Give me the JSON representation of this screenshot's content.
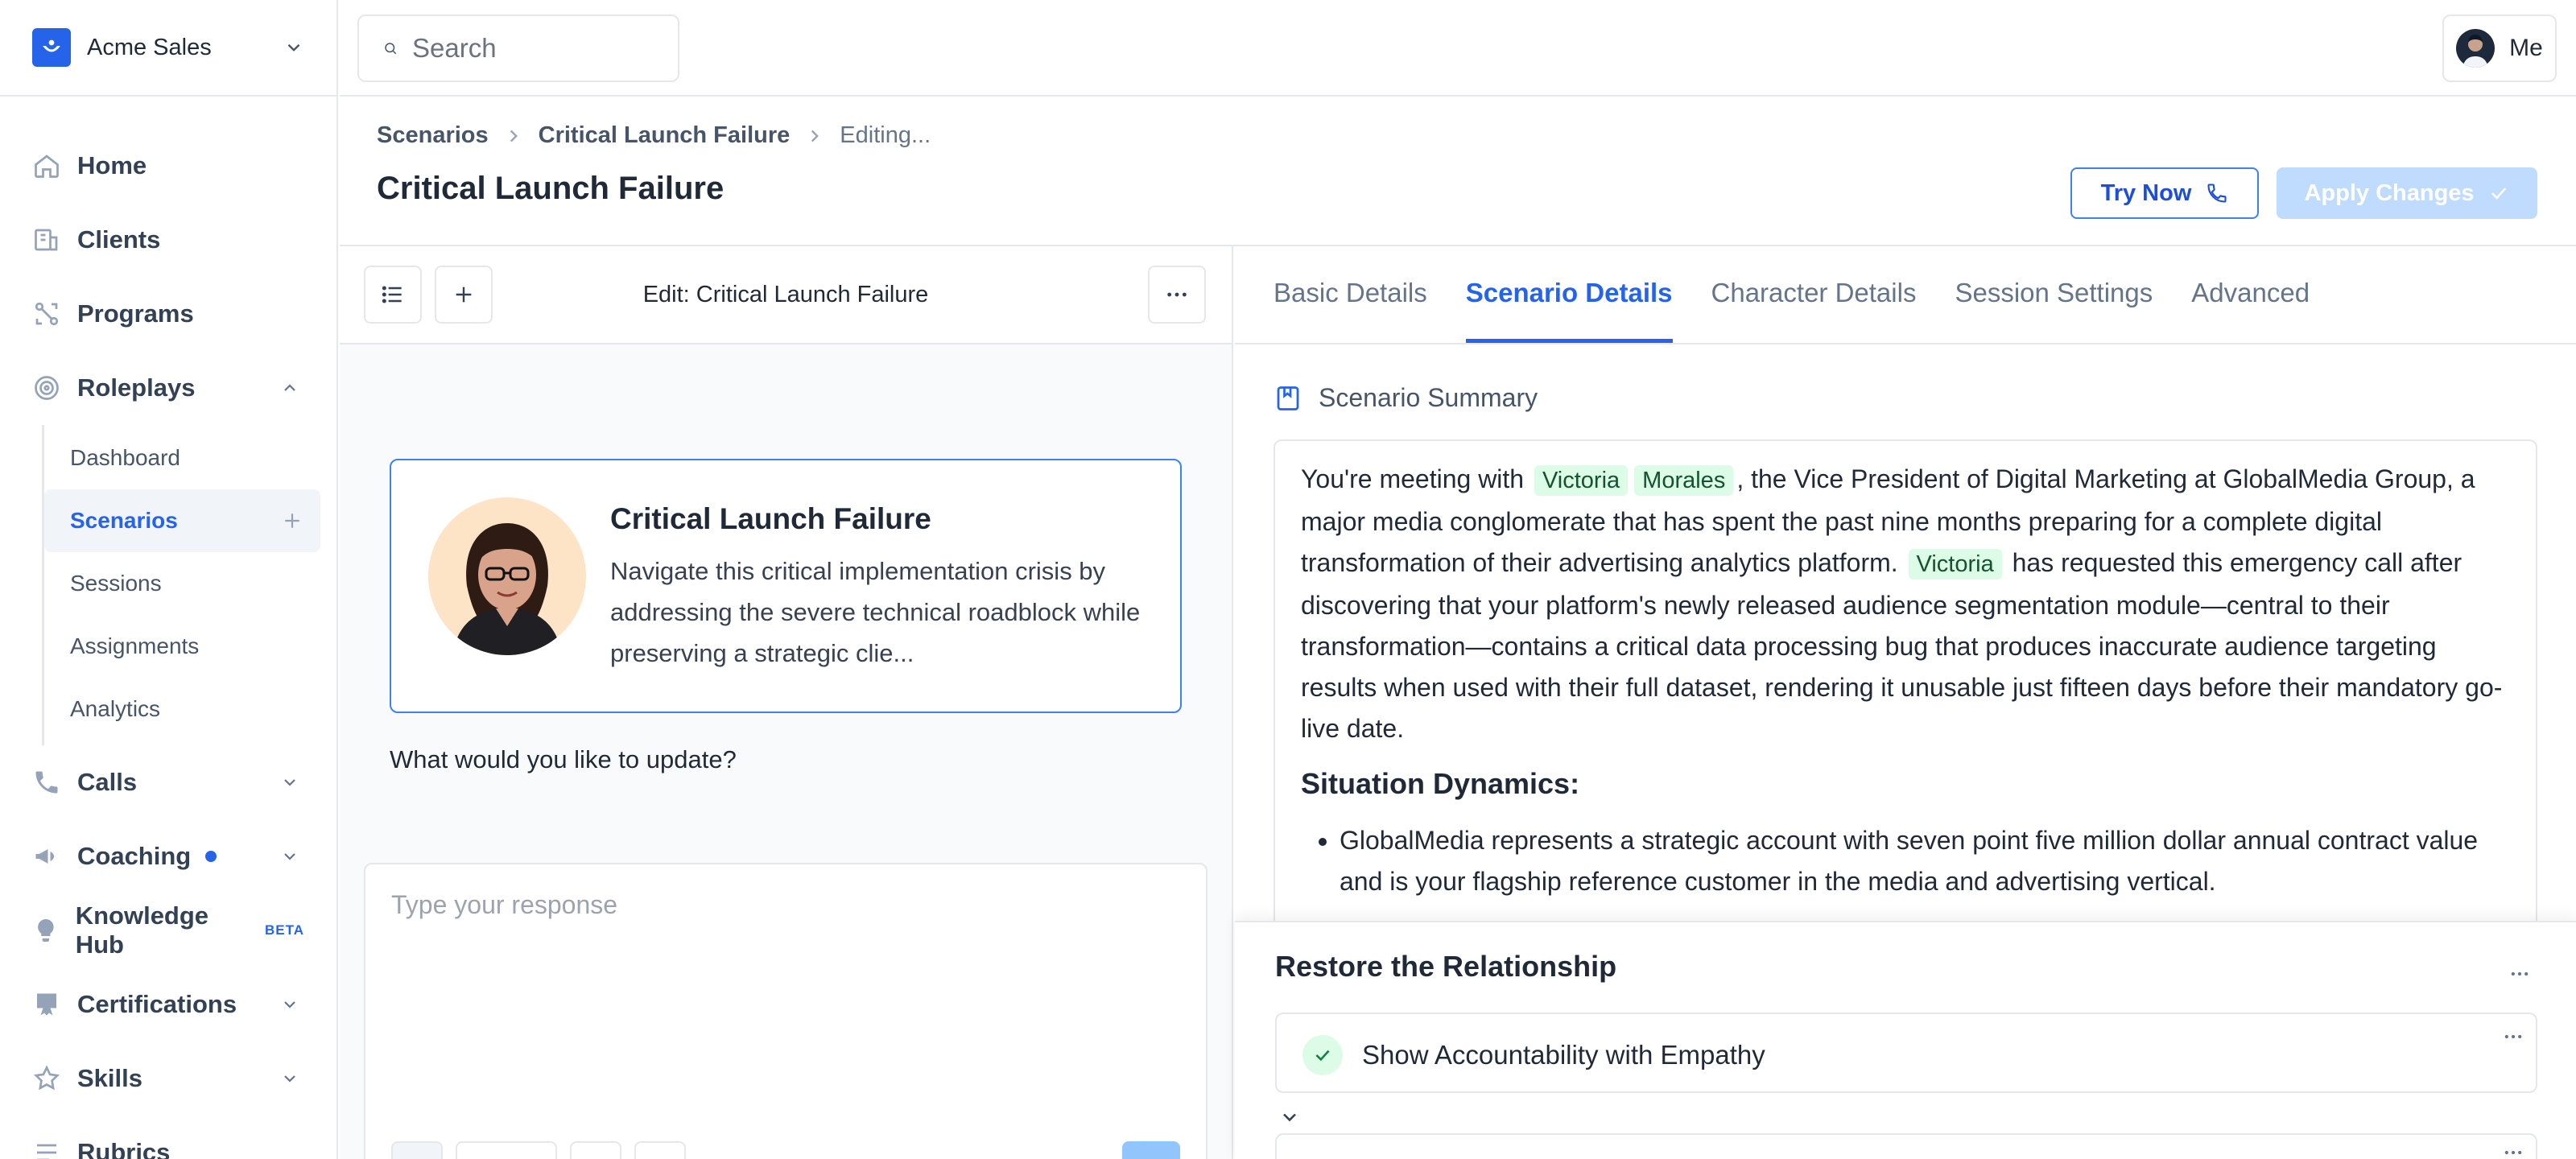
{
  "org": {
    "name": "Acme Sales"
  },
  "search": {
    "placeholder": "Search"
  },
  "user": {
    "label": "Me"
  },
  "nav": {
    "home": "Home",
    "clients": "Clients",
    "programs": "Programs",
    "roleplays": "Roleplays",
    "roleplays_sub": [
      "Dashboard",
      "Scenarios",
      "Sessions",
      "Assignments",
      "Analytics"
    ],
    "calls": "Calls",
    "coaching": "Coaching",
    "knowledge_hub": "Knowledge Hub",
    "beta_badge": "BETA",
    "certifications": "Certifications",
    "skills": "Skills",
    "rubrics": "Rubrics"
  },
  "breadcrumb": [
    "Scenarios",
    "Critical Launch Failure",
    "Editing..."
  ],
  "page": {
    "title": "Critical Launch Failure",
    "try_now": "Try Now",
    "apply_changes": "Apply Changes"
  },
  "editor": {
    "title": "Edit: Critical Launch Failure",
    "card_title": "Critical Launch Failure",
    "card_desc": "Navigate this critical implementation crisis by addressing the severe technical roadblock while preserving a strategic clie...",
    "prompt": "What would you like to update?",
    "reply_placeholder": "Type your response"
  },
  "tabs": [
    "Basic Details",
    "Scenario Details",
    "Character Details",
    "Session Settings",
    "Advanced"
  ],
  "summary": {
    "heading": "Scenario Summary",
    "p1_a": "You're meeting with",
    "chip_first": "Victoria",
    "chip_last": "Morales",
    "p1_b": ", the Vice President of Digital Marketing at GlobalMedia Group, a major media conglomerate that has spent the past nine months preparing for a complete digital transformation of their advertising analytics platform.",
    "chip_first2": "Victoria",
    "p1_c": "has requested this emergency call after discovering that your platform's newly released audience segmentation module—central to their transformation—contains a critical data processing bug that produces inaccurate audience targeting results when used with their full dataset, rendering it unusable just fifteen days before their mandatory go-live date.",
    "section_title": "Situation Dynamics:",
    "bullet1": "GlobalMedia represents a strategic account with seven point five million dollar annual contract value and is your flagship reference customer in the media and advertising vertical."
  },
  "objectives": {
    "title": "Restore the Relationship",
    "items": [
      "Show Accountability with Empathy"
    ]
  },
  "colors": {
    "accent": "#2563eb",
    "chip_bg": "#dcfce7",
    "apply_disabled": "#bfdbfe"
  }
}
